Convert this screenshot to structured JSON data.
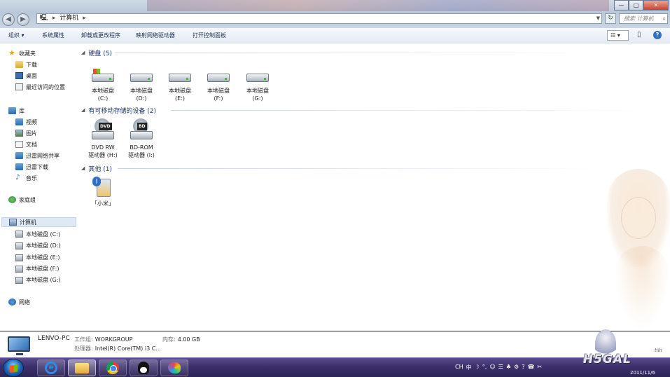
{
  "window": {
    "address": {
      "crumb": "计算机",
      "separator": "▸"
    },
    "search_placeholder": "搜索 计算机",
    "buttons": {
      "minimize": "—",
      "maximize": "□",
      "close": "✕"
    }
  },
  "toolbar": {
    "organize": "组织 ▾",
    "system_properties": "系统属性",
    "uninstall": "卸载或更改程序",
    "map_drive": "映射网络驱动器",
    "control_panel": "打开控制面板",
    "view": "☷ ▾"
  },
  "nav": {
    "favorites": "收藏夹",
    "downloads": "下载",
    "desktop": "桌面",
    "recent": "最近访问的位置",
    "libraries": "库",
    "videos": "视频",
    "pictures": "图片",
    "documents": "文档",
    "xunlei_share": "迅雷网络共享",
    "xunlei_download": "迅雷下载",
    "music": "音乐",
    "homegroup": "家庭组",
    "computer": "计算机",
    "drives": [
      "本地磁盘 (C:)",
      "本地磁盘 (D:)",
      "本地磁盘 (E:)",
      "本地磁盘 (F:)",
      "本地磁盘 (G:)"
    ],
    "network": "网络"
  },
  "content": {
    "groups": {
      "hdd": "硬盘 (5)",
      "removable": "有可移动存储的设备 (2)",
      "other": "其他 (1)"
    },
    "hdd": [
      {
        "name": "本地磁盘",
        "letter": "(C:)"
      },
      {
        "name": "本地磁盘",
        "letter": "(D:)"
      },
      {
        "name": "本地磁盘",
        "letter": "(E:)"
      },
      {
        "name": "本地磁盘",
        "letter": "(F:)"
      },
      {
        "name": "本地磁盘",
        "letter": "(G:)"
      }
    ],
    "removable": [
      {
        "line1": "DVD RW",
        "line2": "驱动器 (H:)",
        "badge": "DVD"
      },
      {
        "line1": "BD-ROM",
        "line2": "驱动器 (I:)",
        "badge": "BD"
      }
    ],
    "other": [
      {
        "name": "「小米」"
      }
    ]
  },
  "details": {
    "pc_name": "LENVO-PC",
    "workgroup_key": "工作组:",
    "workgroup_val": "WORKGROUP",
    "memory_key": "内存:",
    "memory_val": "4.00 GB",
    "cpu_key": "处理器:",
    "cpu_val": "Intel(R) Core(TM) i3 C..."
  },
  "taskbar": {
    "tray": [
      "CH",
      "中",
      "☽",
      "°,",
      "☺",
      "☰",
      "♣",
      "⚙",
      "?",
      "☎",
      "✂"
    ],
    "brand": "H5GAL",
    "date": "2011/11/6",
    "signature": "tiki"
  },
  "colors": {
    "accent": "#1e3a6e",
    "taskbar": "#3b2f6b"
  }
}
